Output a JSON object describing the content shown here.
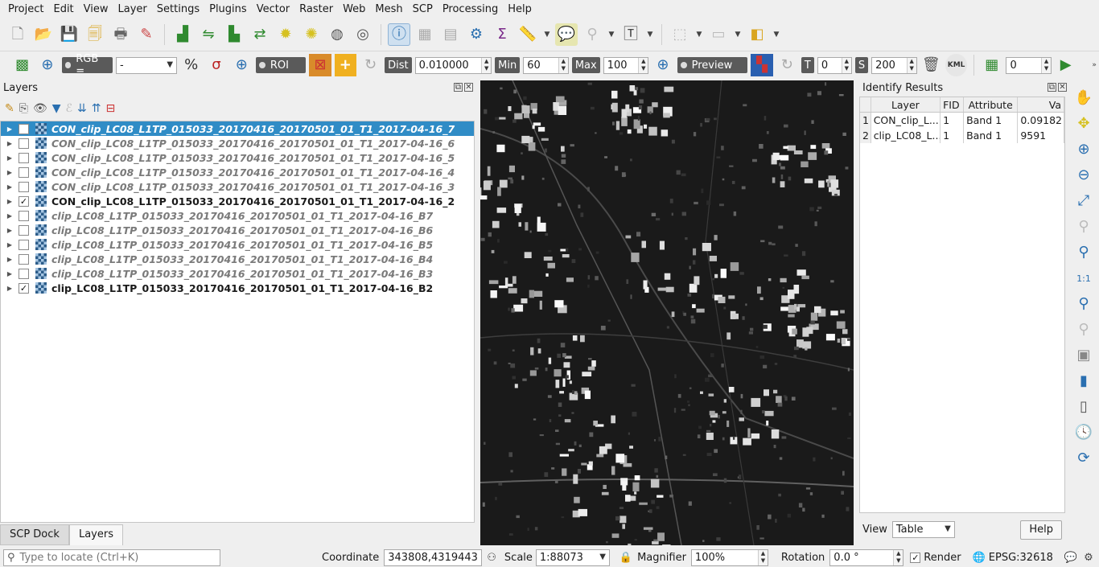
{
  "menu": [
    "Project",
    "Edit",
    "View",
    "Layer",
    "Settings",
    "Plugins",
    "Vector",
    "Raster",
    "Web",
    "Mesh",
    "SCP",
    "Processing",
    "Help"
  ],
  "toolbar1": {
    "icons": [
      "new-project-icon",
      "open-project-icon",
      "save-project-icon",
      "save-as-icon",
      "print-layout-icon",
      "style-manager-icon",
      "histogram-icon",
      "spectral-plot-icon",
      "scatter-plot-icon",
      "band-calc-icon",
      "add-layer-icon",
      "add-raster-icon",
      "add-vector-icon",
      "add-wms-icon",
      "identify-icon",
      "attribute-table-icon",
      "field-calc-icon",
      "processing-gear-icon",
      "statistics-sigma-icon",
      "measure-icon",
      "map-tips-icon",
      "zoom-selection-icon",
      "text-annotation-icon",
      "select-features-icon",
      "deselect-icon",
      "edit-layer-icon"
    ]
  },
  "toolbar2": {
    "rgb_label": "RGB =",
    "rgb_value": "-",
    "roi_label": "ROI",
    "dist_label": "Dist",
    "dist_value": "0.010000",
    "min_label": "Min",
    "min_value": "60",
    "max_label": "Max",
    "max_value": "100",
    "preview_label": "Preview",
    "t_label": "T",
    "t_value": "0",
    "s_label": "S",
    "s_value": "200",
    "kml_label": "KML",
    "band_value": "0"
  },
  "layers_panel": {
    "title": "Layers",
    "items": [
      {
        "name": "CON_clip_LC08_L1TP_015033_20170416_20170501_01_T1_2017-04-16_7",
        "checked": false,
        "selected": true
      },
      {
        "name": "CON_clip_LC08_L1TP_015033_20170416_20170501_01_T1_2017-04-16_6",
        "checked": false,
        "selected": false
      },
      {
        "name": "CON_clip_LC08_L1TP_015033_20170416_20170501_01_T1_2017-04-16_5",
        "checked": false,
        "selected": false
      },
      {
        "name": "CON_clip_LC08_L1TP_015033_20170416_20170501_01_T1_2017-04-16_4",
        "checked": false,
        "selected": false
      },
      {
        "name": "CON_clip_LC08_L1TP_015033_20170416_20170501_01_T1_2017-04-16_3",
        "checked": false,
        "selected": false
      },
      {
        "name": "CON_clip_LC08_L1TP_015033_20170416_20170501_01_T1_2017-04-16_2",
        "checked": true,
        "selected": false
      },
      {
        "name": "clip_LC08_L1TP_015033_20170416_20170501_01_T1_2017-04-16_B7",
        "checked": false,
        "selected": false
      },
      {
        "name": "clip_LC08_L1TP_015033_20170416_20170501_01_T1_2017-04-16_B6",
        "checked": false,
        "selected": false
      },
      {
        "name": "clip_LC08_L1TP_015033_20170416_20170501_01_T1_2017-04-16_B5",
        "checked": false,
        "selected": false
      },
      {
        "name": "clip_LC08_L1TP_015033_20170416_20170501_01_T1_2017-04-16_B4",
        "checked": false,
        "selected": false
      },
      {
        "name": "clip_LC08_L1TP_015033_20170416_20170501_01_T1_2017-04-16_B3",
        "checked": false,
        "selected": false
      },
      {
        "name": "clip_LC08_L1TP_015033_20170416_20170501_01_T1_2017-04-16_B2",
        "checked": true,
        "selected": false
      }
    ]
  },
  "tabs": [
    "SCP Dock",
    "Layers"
  ],
  "identify": {
    "title": "Identify Results",
    "columns": [
      "Layer",
      "FID",
      "Attribute",
      "Va"
    ],
    "rows": [
      {
        "n": "1",
        "layer": "CON_clip_L...",
        "fid": "1",
        "attr": "Band 1",
        "value": "0.09182"
      },
      {
        "n": "2",
        "layer": "clip_LC08_L...",
        "fid": "1",
        "attr": "Band 1",
        "value": "9591"
      }
    ],
    "view_label": "View",
    "view_value": "Table",
    "help_label": "Help"
  },
  "status": {
    "locate_placeholder": "Type to locate (Ctrl+K)",
    "coordinate_label": "Coordinate",
    "coordinate_value": "343808,4319443",
    "scale_label": "Scale",
    "scale_value": "1:88073",
    "magnifier_label": "Magnifier",
    "magnifier_value": "100%",
    "rotation_label": "Rotation",
    "rotation_value": "0.0 °",
    "render_label": "Render",
    "crs_label": "EPSG:32618"
  },
  "colors": {
    "selection": "#308cc6",
    "canvas_bg": "#1b1b1b"
  }
}
